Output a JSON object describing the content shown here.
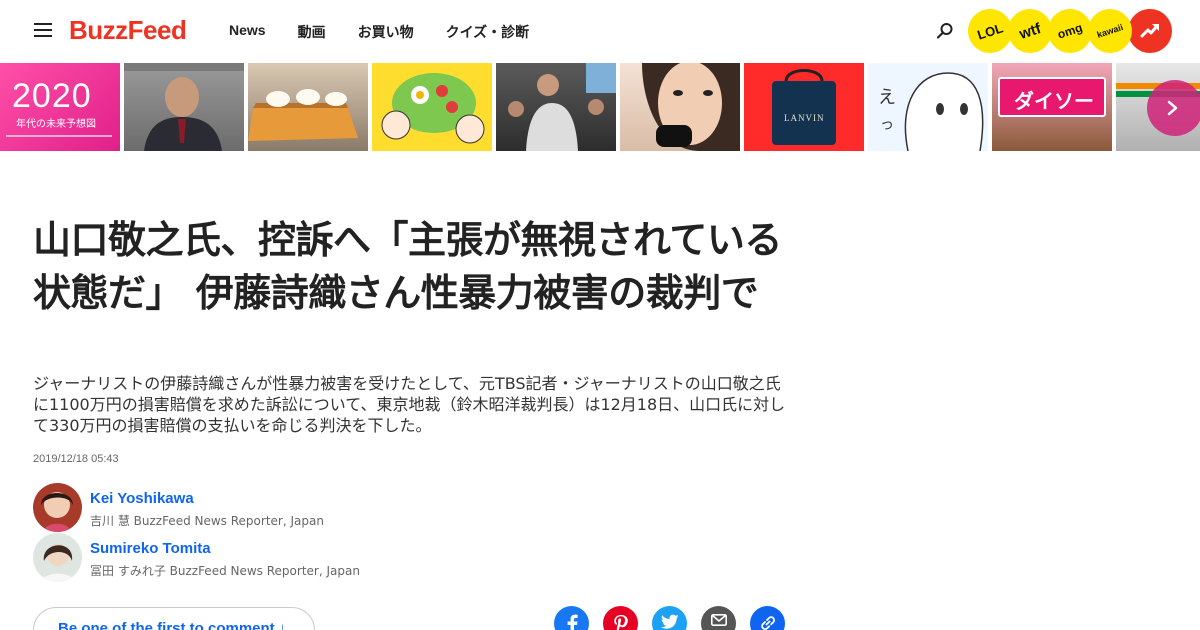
{
  "header": {
    "logo": "BuzzFeed",
    "nav": [
      "News",
      "動画",
      "お買い物",
      "クイズ・診断"
    ],
    "badges": [
      "LOL",
      "wtf",
      "omg",
      "kawaii"
    ],
    "brand_color": "#ee3322",
    "badge_color": "#ffe600"
  },
  "strip": {
    "first_card_title": "2020",
    "first_card_subtitle": "年代の未来予想図",
    "thumb_daiso_text": "ダイソー",
    "thumb_lanvin_text": "LANVIN"
  },
  "article": {
    "title": "山口敬之氏、控訴へ「主張が無視されている状態だ」 伊藤詩織さん性暴力被害の裁判で",
    "lede": "ジャーナリストの伊藤詩織さんが性暴力被害を受けたとして、元TBS記者・ジャーナリストの山口敬之氏に1100万円の損害賠償を求めた訴訟について、東京地裁（鈴木昭洋裁判長）は12月18日、山口氏に対して330万円の損害賠償の支払いを命じる判決を下した。",
    "timestamp": "2019/12/18 05:43"
  },
  "authors": [
    {
      "name": "Kei Yoshikawa",
      "role": "吉川 慧 BuzzFeed News Reporter, Japan"
    },
    {
      "name": "Sumireko Tomita",
      "role": "冨田 すみれ子 BuzzFeed News Reporter, Japan"
    }
  ],
  "comments": {
    "button_label": "Be one of the first to comment ↓"
  },
  "share": {
    "services": [
      "facebook",
      "pinterest",
      "twitter",
      "email",
      "link"
    ],
    "colors": {
      "facebook": "#1877f2",
      "pinterest": "#e60023",
      "twitter": "#1da1f2",
      "email": "#555555",
      "link": "#0f65ef"
    }
  }
}
